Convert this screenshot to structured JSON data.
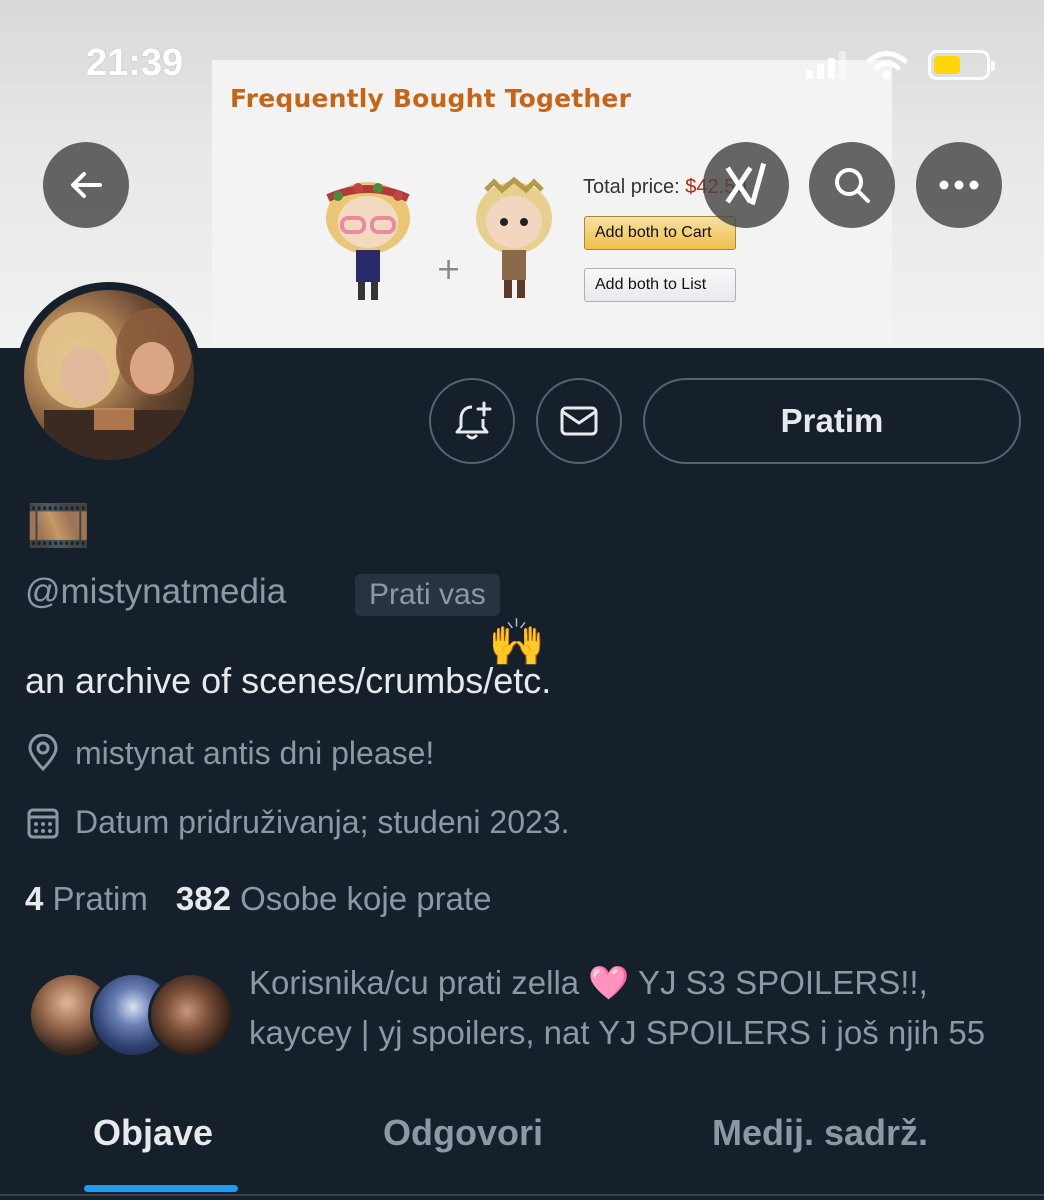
{
  "status_bar": {
    "time": "21:39"
  },
  "banner": {
    "title": "Frequently Bought Together",
    "total_price_label": "Total price:",
    "total_price_value": "$42.50",
    "plus": "+",
    "add_to_cart_label": "Add both to Cart",
    "add_to_list_label": "Add both to List"
  },
  "header": {
    "back_icon": "arrow-left-icon",
    "grok_icon": "grok-icon",
    "search_icon": "search-icon",
    "more_icon": "more-horizontal-icon"
  },
  "profile": {
    "display_name": "🎞️",
    "handle": "@mistynatmedia",
    "follows_you_label": "Prati vas",
    "follows_you_emoji": "🙌",
    "bio": "an archive of scenes/crumbs/etc.",
    "location": "mistynat antis dni please!",
    "joined": "Datum pridruživanja; studeni 2023.",
    "following_count": "4",
    "following_label": "Pratim",
    "followers_count": "382",
    "followers_label": "Osobe koje prate",
    "followed_by_text": "Korisnika/cu prati zella 🩷 YJ S3 SPOILERS!!, kaycey | yj spoilers, nat YJ SPOILERS i još njih 55"
  },
  "actions": {
    "notify_icon": "bell-plus-icon",
    "message_icon": "envelope-icon",
    "follow_button_label": "Pratim"
  },
  "tabs": [
    {
      "label": "Objave",
      "active": true
    },
    {
      "label": "Odgovori",
      "active": false
    },
    {
      "label": "Medij. sadrž.",
      "active": false
    }
  ],
  "colors": {
    "background": "#15202b",
    "accent": "#1d9bf0",
    "secondary_text": "#8b98a5",
    "border": "#536471"
  }
}
